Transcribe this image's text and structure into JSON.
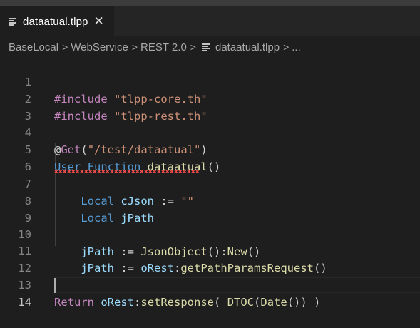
{
  "tab": {
    "label": "dataatual.tlpp",
    "close_glyph": "✕"
  },
  "breadcrumb": {
    "items": [
      "BaseLocal",
      "WebService",
      "REST 2.0",
      "dataatual.tlpp",
      "..."
    ],
    "separator": ">"
  },
  "editor": {
    "line_numbers": [
      "1",
      "2",
      "3",
      "4",
      "5",
      "6",
      "7",
      "8",
      "9",
      "10",
      "11",
      "12",
      "13",
      "14"
    ],
    "active_line": "14",
    "lines": {
      "l1": {
        "a": "#include",
        "b": " ",
        "c": "\"tlpp-core.th\""
      },
      "l2": {
        "a": "#include",
        "b": " ",
        "c": "\"tlpp-rest.th\""
      },
      "l4": {
        "a": "@",
        "b": "Get",
        "c": "(",
        "d": "\"/test/dataatual\"",
        "e": ")"
      },
      "l5": {
        "a": "User",
        "b": " ",
        "c": "Function",
        "d": " ",
        "e": "dataatual",
        "f": "()"
      },
      "l7": {
        "indent": "    ",
        "a": "Local",
        "b": " ",
        "c": "cJson",
        "d": " := ",
        "e": "\"\""
      },
      "l8": {
        "indent": "    ",
        "a": "Local",
        "b": " ",
        "c": "jPath"
      },
      "l10": {
        "indent": "    ",
        "a": "jPath",
        "b": " := ",
        "c": "JsonObject",
        "d": "():",
        "e": "New",
        "f": "()"
      },
      "l11": {
        "indent": "    ",
        "a": "jPath",
        "b": " := ",
        "c": "oRest",
        "d": ":",
        "e": "getPathParamsRequest",
        "f": "()"
      },
      "l13": {
        "a": "Return",
        "b": " ",
        "c": "oRest",
        "d": ":",
        "e": "setResponse",
        "f": "( ",
        "g": "DTOC",
        "h": "(",
        "i": "Date",
        "j": "()) )"
      }
    }
  },
  "colors": {
    "background": "#1e1e1e",
    "keyword_control": "#c586c0",
    "string": "#ce9178",
    "keyword": "#569cd6",
    "function": "#dcdcaa",
    "variable": "#9cdcfe",
    "error_squiggle": "#f14c4c"
  },
  "icons": {
    "file": "file-lines-icon",
    "close": "close-icon"
  }
}
